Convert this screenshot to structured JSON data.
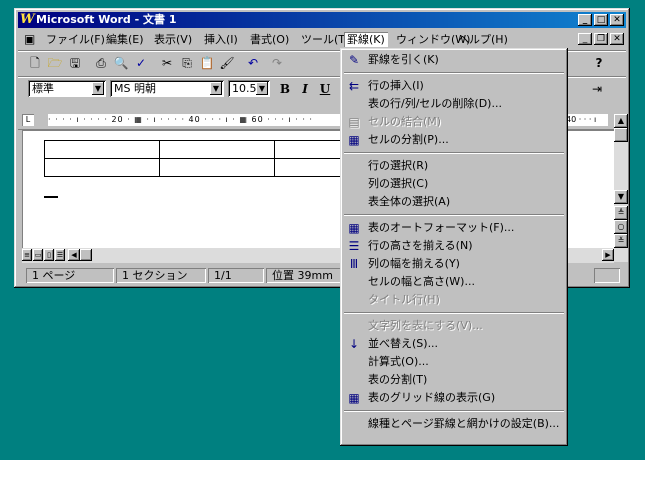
{
  "window": {
    "title": "Microsoft Word - 文書 1",
    "minimize": "_",
    "maximize": "□",
    "close": "✕"
  },
  "menubar": {
    "items": [
      "ファイル(F)",
      "編集(E)",
      "表示(V)",
      "挿入(I)",
      "書式(O)",
      "ツール(T)",
      "罫線(K)",
      "ウィンドウ(W)",
      "ヘルプ(H)"
    ],
    "active_index": 6,
    "doc_min": "_",
    "doc_restore": "❐",
    "doc_close": "✕"
  },
  "formatting": {
    "style": "標準",
    "font": "MS 明朝",
    "size": "10.5",
    "bold": "B",
    "italic": "I",
    "underline": "U"
  },
  "ruler": {
    "text": "· · · · ı · · · · 20 · ▦ · ı · · · · 40 · · · ı · ▦ 60 · · · ı · · ·",
    "right_text": "40 · · · ı"
  },
  "status": {
    "page": "1 ページ",
    "section": "1 セクション",
    "pages": "1/1",
    "position": "位置 39mm"
  },
  "table_menu": {
    "items": [
      {
        "label": "罫線を引く(K)",
        "icon": "pencil-icon",
        "glyph": "✎",
        "disabled": false
      },
      {
        "sep": true
      },
      {
        "label": "行の挿入(I)",
        "icon": "insert-row-icon",
        "glyph": "⇇",
        "disabled": false
      },
      {
        "label": "表の行/列/セルの削除(D)...",
        "icon": "",
        "glyph": "",
        "disabled": false
      },
      {
        "label": "セルの結合(M)",
        "icon": "merge-cells-icon",
        "glyph": "▤",
        "disabled": true
      },
      {
        "label": "セルの分割(P)...",
        "icon": "split-cells-icon",
        "glyph": "▦",
        "disabled": false
      },
      {
        "sep": true
      },
      {
        "label": "行の選択(R)",
        "icon": "",
        "glyph": "",
        "disabled": false
      },
      {
        "label": "列の選択(C)",
        "icon": "",
        "glyph": "",
        "disabled": false
      },
      {
        "label": "表全体の選択(A)",
        "icon": "",
        "glyph": "",
        "disabled": false
      },
      {
        "sep": true
      },
      {
        "label": "表のオートフォーマット(F)...",
        "icon": "autoformat-icon",
        "glyph": "▦",
        "disabled": false
      },
      {
        "label": "行の高さを揃える(N)",
        "icon": "distribute-rows-icon",
        "glyph": "☰",
        "disabled": false
      },
      {
        "label": "列の幅を揃える(Y)",
        "icon": "distribute-columns-icon",
        "glyph": "Ⅲ",
        "disabled": false
      },
      {
        "label": "セルの幅と高さ(W)...",
        "icon": "",
        "glyph": "",
        "disabled": false
      },
      {
        "label": "タイトル行(H)",
        "icon": "",
        "glyph": "",
        "disabled": true
      },
      {
        "sep": true
      },
      {
        "label": "文字列を表にする(V)...",
        "icon": "",
        "glyph": "",
        "disabled": true
      },
      {
        "label": "並べ替え(S)...",
        "icon": "sort-icon",
        "glyph": "↓",
        "disabled": false
      },
      {
        "label": "計算式(O)...",
        "icon": "",
        "glyph": "",
        "disabled": false
      },
      {
        "label": "表の分割(T)",
        "icon": "",
        "glyph": "",
        "disabled": false
      },
      {
        "label": "表のグリッド線の表示(G)",
        "icon": "gridlines-icon",
        "glyph": "▦",
        "disabled": false
      },
      {
        "sep": true
      },
      {
        "label": "線種とページ罫線と網かけの設定(B)...",
        "icon": "",
        "glyph": "",
        "disabled": false
      }
    ]
  }
}
